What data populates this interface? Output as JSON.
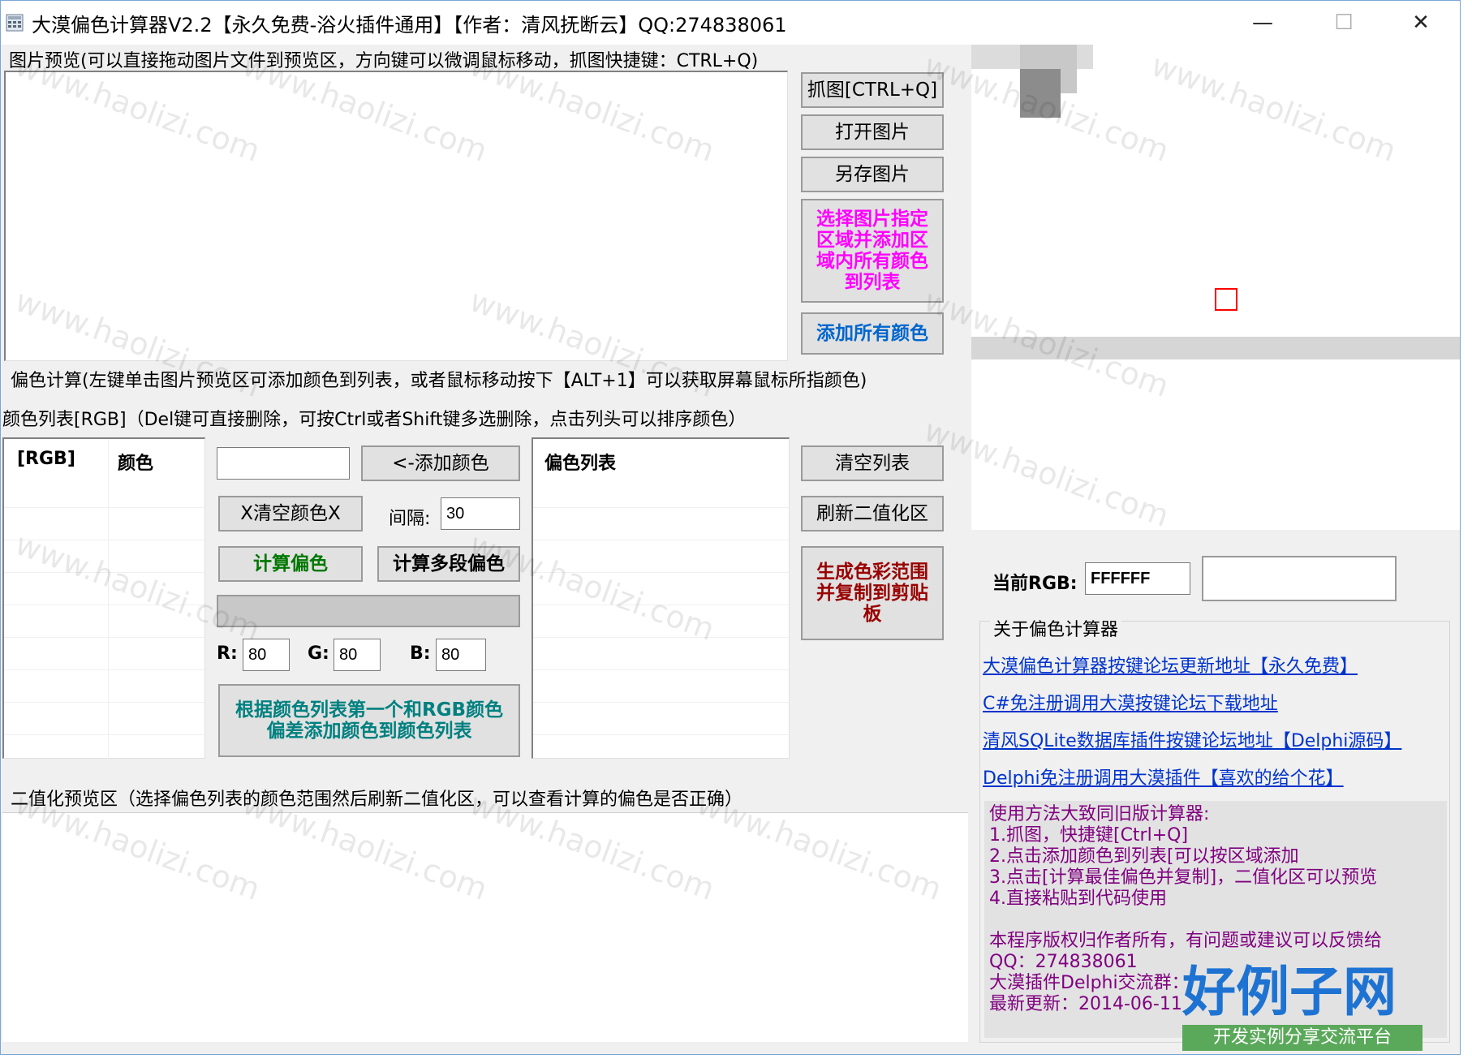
{
  "window": {
    "title": "大漠偏色计算器V2.2【永久免费-浴火插件通用】【作者：清风抚断云】QQ:274838061",
    "icons": {
      "app": "calculator-icon",
      "minimize": "minimize-icon",
      "maximize": "maximize-icon",
      "close": "close-icon"
    },
    "glyphs": {
      "minimize": "—",
      "maximize": "☐",
      "close": "✕"
    }
  },
  "preview": {
    "label": "图片预览(可以直接拖动图片文件到预览区，方向键可以微调鼠标移动，抓图快捷键：CTRL+Q)"
  },
  "buttons": {
    "capture": "抓图[CTRL+Q]",
    "open": "打开图片",
    "save_as": "另存图片",
    "select_region": "选择图片指定区域并添加区域内所有颜色到列表",
    "add_all": "添加所有颜色",
    "add_color": "<-添加颜色",
    "clear_color": "X清空颜色X",
    "calc": "计算偏色",
    "calc_multi": "计算多段偏色",
    "add_by_diff": "根据颜色列表第一个和RGB颜色偏差添加颜色到颜色列表",
    "clear_list": "清空列表",
    "refresh_binary": "刷新二值化区",
    "generate_copy": "生成色彩范围并复制到剪贴板"
  },
  "colors": {
    "magenta": "#ff00ff",
    "blue": "#0066cc",
    "green": "#007700",
    "teal": "#008080",
    "maroon": "#990000",
    "link": "#0033cc",
    "usage": "#800080"
  },
  "calc_section": {
    "label": "偏色计算(左键单击图片预览区可添加颜色到列表，或者鼠标移动按下【ALT+1】可以获取屏幕鼠标所指颜色)",
    "list_label": "颜色列表[RGB]（Del键可直接删除，可按Ctrl或者Shift键多选删除，点击列头可以排序颜色）",
    "columns": [
      "[RGB]",
      "颜色"
    ],
    "interval_label": "间隔:",
    "interval_value": "30",
    "color_input": "",
    "r_label": "R:",
    "r_value": "80",
    "g_label": "G:",
    "g_value": "80",
    "b_label": "B:",
    "b_value": "80",
    "offset_list_header": "偏色列表"
  },
  "binary": {
    "label": "二值化预览区（选择偏色列表的颜色范围然后刷新二值化区，可以查看计算的偏色是否正确）"
  },
  "right": {
    "rgb_label": "当前RGB:",
    "rgb_value": "FFFFFF",
    "about_label": "关于偏色计算器",
    "links": [
      "大漠偏色计算器按键论坛更新地址【永久免费】",
      "C#免注册调用大漠按键论坛下载地址",
      "清风SQLite数据库插件按键论坛地址【Delphi源码】",
      "Delphi免注册调用大漠插件【喜欢的给个花】"
    ],
    "usage": [
      "使用方法大致同旧版计算器:",
      "1.抓图，快捷键[Ctrl+Q]",
      "2.点击添加颜色到列表[可以按区域添加",
      "3.点击[计算最佳偏色并复制]，二值化区可以预览",
      "4.直接粘贴到代码使用",
      "",
      "本程序版权归作者所有，有问题或建议可以反馈给",
      "QQ：274838061",
      "大漠插件Delphi交流群：",
      "最新更新：2014-06-11"
    ]
  },
  "watermark": {
    "text": "www.haolizi.com",
    "logo_title": "好例子网",
    "logo_subtitle": "开发实例分享交流平台"
  }
}
